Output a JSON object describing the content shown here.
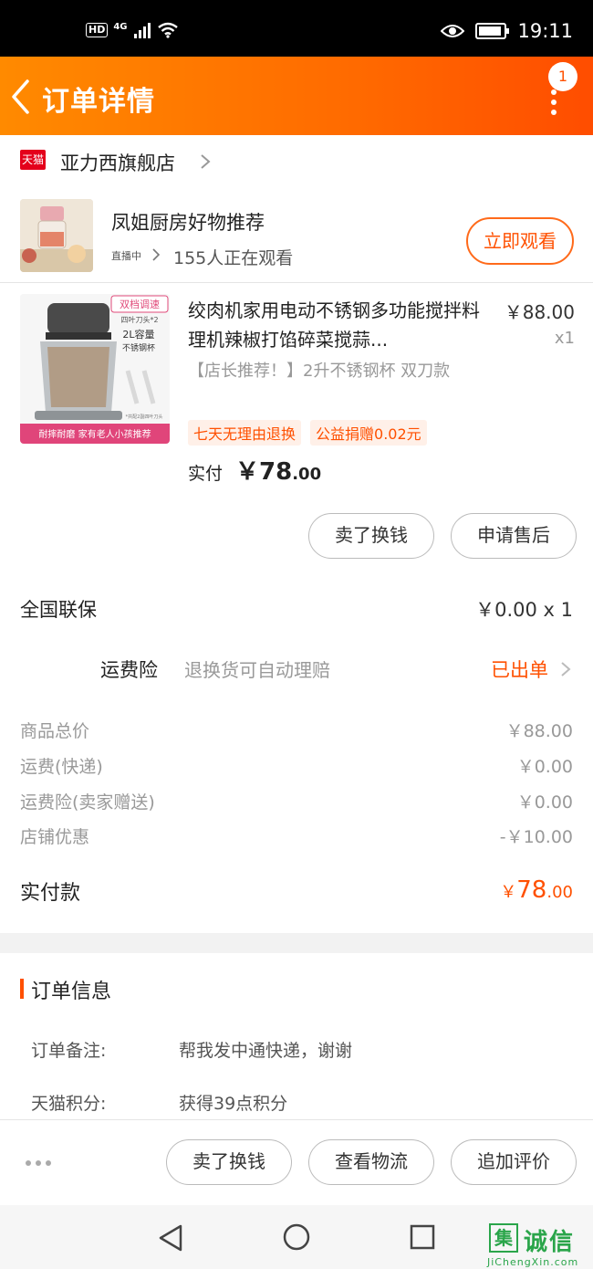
{
  "status_bar": {
    "hd": "HD",
    "network": "4G",
    "time": "19:11"
  },
  "header": {
    "title": "订单详情",
    "badge_count": "1"
  },
  "shop": {
    "tmall_logo_text": "天猫",
    "name": "亚力西旗舰店"
  },
  "live": {
    "title": "凤姐厨房好物推荐",
    "tag": "直播中",
    "viewers": "155人正在观看",
    "watch_button": "立即观看"
  },
  "product": {
    "title": "绞肉机家用电动不锈钢多功能搅拌料理机辣椒打馅碎菜搅蒜...",
    "price": "￥88.00",
    "quantity": "x1",
    "sku": "【店长推荐！】2升不锈钢杯 双刀款",
    "tags": [
      "七天无理由退换",
      "公益捐赠0.02元"
    ],
    "paid_label": "实付",
    "paid_symbol": "￥",
    "paid_integer": "78",
    "paid_decimal": ".00",
    "image_texts": {
      "top": "双档调速",
      "sub": "四叶刀头*2",
      "cap": "2L容量",
      "cap2": "不锈钢杯",
      "bottom": "耐摔耐磨  家有老人小孩推荐",
      "note": "*共配2副四叶刀头"
    }
  },
  "item_actions": {
    "sell": "卖了换钱",
    "after_sale": "申请售后"
  },
  "insurance": {
    "label": "全国联保",
    "value": "￥0.00 x 1"
  },
  "freight": {
    "label": "运费险",
    "desc": "退换货可自动理赔",
    "status": "已出单"
  },
  "summary": [
    {
      "label": "商品总价",
      "value": "￥88.00"
    },
    {
      "label": "运费(快递)",
      "value": "￥0.00"
    },
    {
      "label": "运费险(卖家赠送)",
      "value": "￥0.00"
    },
    {
      "label": "店铺优惠",
      "value": "-￥10.00"
    }
  ],
  "total": {
    "label": "实付款",
    "symbol": "￥",
    "integer": "78",
    "decimal": ".00"
  },
  "order_info": {
    "title": "订单信息",
    "rows": [
      {
        "label": "订单备注:",
        "value": "帮我发中通快递，谢谢"
      },
      {
        "label": "天猫积分:",
        "value": "获得39点积分"
      }
    ]
  },
  "bottom_actions": {
    "sell": "卖了换钱",
    "logistics": "查看物流",
    "review": "追加评价"
  },
  "watermark": {
    "char": "集",
    "text": "诚信",
    "url": "JiChengXin.com"
  },
  "colors": {
    "accent": "#ff5000",
    "header_start": "#ff8a00",
    "header_end": "#ff4d00",
    "tmall_red": "#e4001b"
  }
}
